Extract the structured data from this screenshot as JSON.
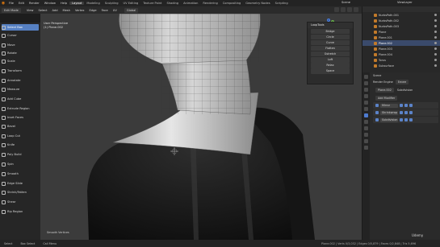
{
  "app": {
    "name": "Blender"
  },
  "menubar": {
    "menus": [
      "File",
      "Edit",
      "Render",
      "Window",
      "Help"
    ],
    "workspaces": [
      "Layout",
      "Modeling",
      "Sculpting",
      "UV Editing",
      "Texture Paint",
      "Shading",
      "Animation",
      "Rendering",
      "Compositing",
      "Geometry Nodes",
      "Scripting"
    ],
    "active_workspace": "Layout",
    "scene": "Scene",
    "view_layer": "ViewLayer"
  },
  "header": {
    "mode": "Edit Mode",
    "items": [
      "View",
      "Select",
      "Add",
      "Mesh",
      "Vertex",
      "Edge",
      "Face",
      "UV"
    ],
    "transform": "Global"
  },
  "toolbar": {
    "tools": [
      "Select Box",
      "Cursor",
      "Move",
      "Rotate",
      "Scale",
      "Transform",
      "Annotate",
      "Measure",
      "Add Cube",
      "Extrude Region",
      "Inset Faces",
      "Bevel",
      "Loop Cut",
      "Knife",
      "Poly Build",
      "Spin",
      "Smooth",
      "Edge Slide",
      "Shrink/Fatten",
      "Shear",
      "Rip Region"
    ],
    "active_tool": "Select Box"
  },
  "viewport": {
    "view_name": "User Perspective",
    "object_name": "(1) Plane.002",
    "gizmo_axes": [
      "X",
      "Y",
      "Z"
    ]
  },
  "looptools": {
    "title": "LoopTools",
    "items": [
      "Bridge",
      "Circle",
      "Curve",
      "Flatten",
      "Gstretch",
      "Loft",
      "Relax",
      "Space"
    ]
  },
  "outliner": {
    "rows": [
      {
        "label": "NurbsPath.001"
      },
      {
        "label": "NurbsPath.002"
      },
      {
        "label": "NurbsPath.003"
      },
      {
        "label": "Plane"
      },
      {
        "label": "Plane.001"
      },
      {
        "label": "Plane.002"
      },
      {
        "label": "Plane.003"
      },
      {
        "label": "Plane.004"
      },
      {
        "label": "Torus"
      },
      {
        "label": "Subsurface"
      }
    ],
    "selected": "Plane.002"
  },
  "properties": {
    "scene_label": "Scene",
    "render_engine_label": "Render Engine",
    "render_engine_value": "Eevee",
    "object": "Plane.002",
    "modifier_target": "Subdivision",
    "add_modifier": "Add Modifier",
    "modifiers": [
      "Mirror",
      "Shrinkwrap",
      "Subdivision"
    ]
  },
  "statusbar": {
    "left": "Select",
    "mid1": "Box Select",
    "mid2": "Call Menu",
    "right": "Plane.002 | Verts 0/3,032 | Edges 0/5,879 | Faces 0/2,848 | Tris 5,696"
  },
  "overlay": {
    "watermark": "Udemy",
    "hint": "Smooth Vertices"
  },
  "colors": {
    "active_blue": "#5680c2",
    "accent_orange": "#e87d0d",
    "selected_row": "#3a4a6b"
  }
}
